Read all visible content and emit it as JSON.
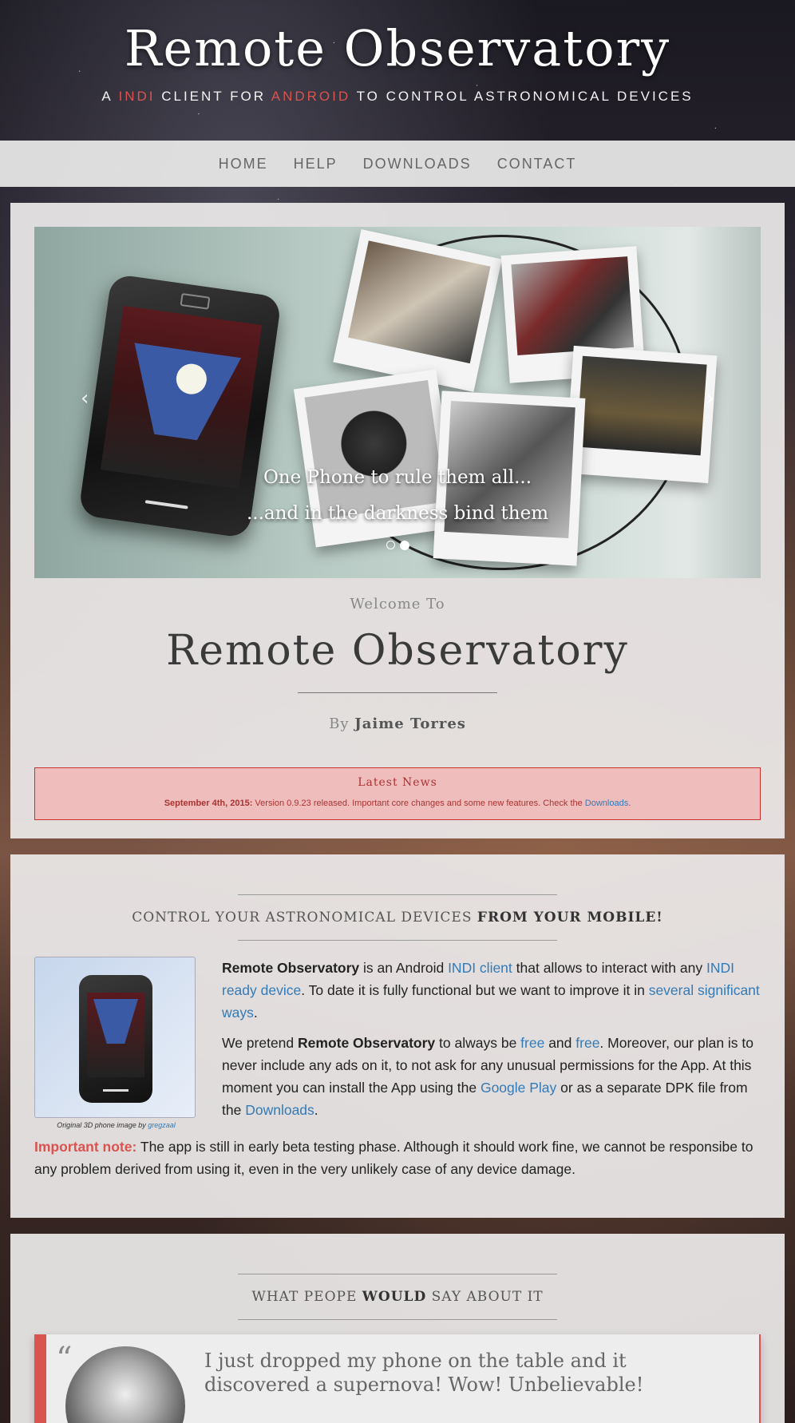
{
  "header": {
    "title": "Remote Observatory",
    "tagline_parts": [
      "A ",
      "INDI",
      " CLIENT FOR ",
      "ANDROID",
      " TO CONTROL ASTRONOMICAL DEVICES"
    ]
  },
  "nav": {
    "items": [
      {
        "label": "HOME"
      },
      {
        "label": "HELP"
      },
      {
        "label": "DOWNLOADS"
      },
      {
        "label": "CONTACT"
      }
    ]
  },
  "carousel": {
    "caption_line1": "One Phone to rule them all...",
    "caption_line2": "...and in the darkness bind them",
    "prev_icon": "chevron-left-icon",
    "next_icon": "chevron-right-icon",
    "prev_glyph": "‹",
    "next_glyph": "›",
    "slide_count": 2,
    "active_slide": 2
  },
  "welcome": {
    "welcome_to": "Welcome To",
    "title": "Remote Observatory",
    "by": "By",
    "author": "Jaime Torres"
  },
  "news": {
    "title": "Latest News",
    "date": "September 4th, 2015:",
    "text": " Version 0.9.23 released. Important core changes and some new features. Check the ",
    "link": "Downloads",
    "end": "."
  },
  "control_section": {
    "title_light": "CONTROL YOUR ASTRONOMICAL DEVICES ",
    "title_bold": "FROM YOUR MOBILE!",
    "caption_text": "Original 3D phone image by ",
    "caption_link": "gregzaal",
    "p1": {
      "b1": "Remote Observatory",
      "t1": " is an Android ",
      "a1": "INDI client",
      "t2": " that allows to interact with any ",
      "a2": "INDI ready device",
      "t3": ". To date it is fully functional but we want to improve it in ",
      "a3": "several significant ways",
      "t4": "."
    },
    "p2": {
      "t1": "We pretend ",
      "b1": "Remote Observatory",
      "t2": " to always be ",
      "a1": "free",
      "t3": " and ",
      "a2": "free",
      "t4": ". Moreover, our plan is to never include any ads on it, to not ask for any unusual permissions for the App. At this moment you can install the App using the ",
      "a3": "Google Play",
      "t5": " or as a separate DPK file from the ",
      "a4": "Downloads",
      "t6": "."
    },
    "important_label": "Important note:",
    "important_text": " The app is still in early beta testing phase. Although it should work fine, we cannot be responsibe to any problem derived from using it, even in the very unlikely case of any device damage."
  },
  "testimonials_section": {
    "title_light1": "WHAT PEOPE ",
    "title_bold": "WOULD",
    "title_light2": " SAY ABOUT IT",
    "quote_mark": "“",
    "quote": "I just dropped my phone on the table and it discovered a supernova! Wow! Unbelievable!"
  },
  "colors": {
    "accent_red": "#d9534f",
    "link_blue": "#337ab7"
  }
}
